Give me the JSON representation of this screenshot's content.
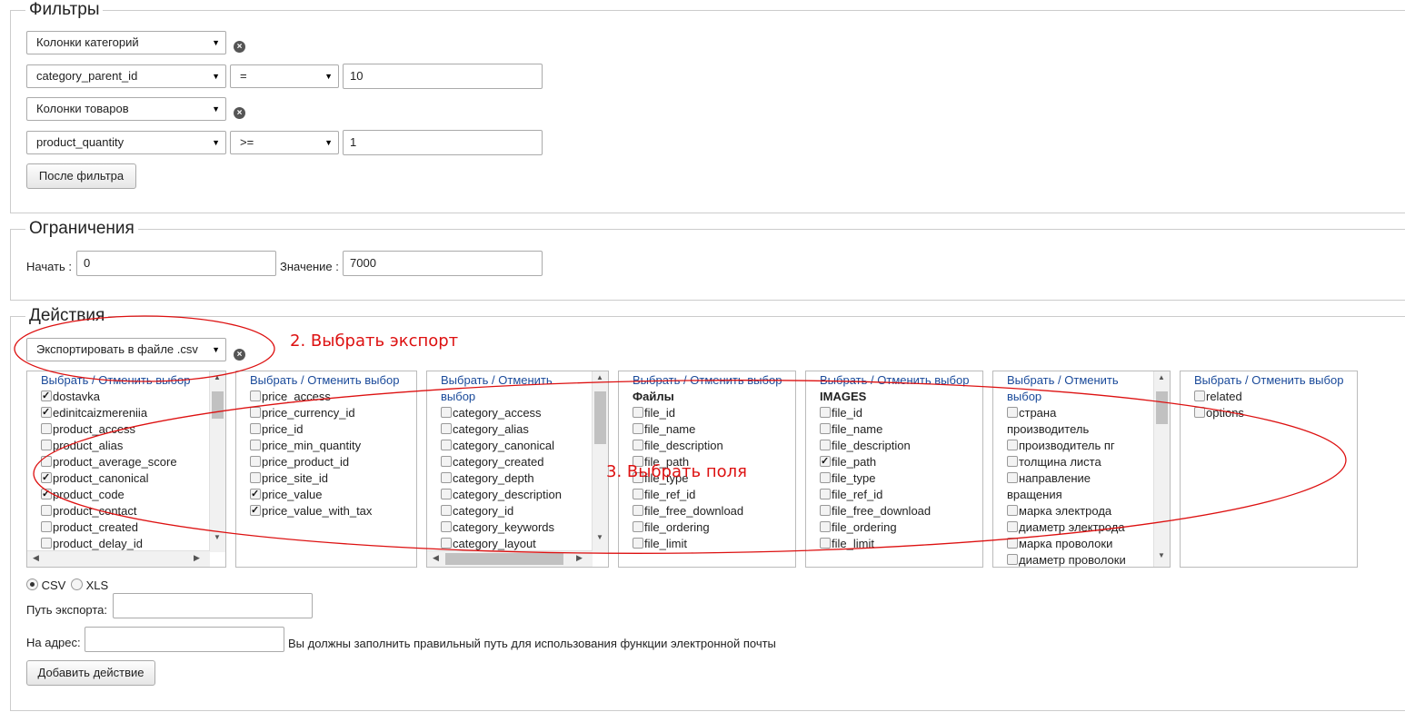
{
  "filters": {
    "legend": "Фильтры",
    "row1": {
      "select": "Колонки категорий"
    },
    "row2": {
      "field": "category_parent_id",
      "op": "=",
      "value": "10"
    },
    "row3": {
      "select": "Колонки товаров"
    },
    "row4": {
      "field": "product_quantity",
      "op": ">=",
      "value": "1"
    },
    "after_button": "После фильтра"
  },
  "limits": {
    "legend": "Ограничения",
    "start_label": "Начать :",
    "start_value": "0",
    "value_label": "Значение :",
    "value_value": "7000"
  },
  "actions": {
    "legend": "Действия",
    "action_select": "Экспортировать в файле .csv",
    "select_label": "Выбрать",
    "sep": "/",
    "unselect_label": "Отменить выбор",
    "unselect_wrap1": "Отменить",
    "unselect_wrap2": "выбор",
    "boxes": [
      {
        "items": [
          {
            "t": "dostavka",
            "c": true
          },
          {
            "t": "edinitcaizmereniia",
            "c": true
          },
          {
            "t": "product_access",
            "c": false
          },
          {
            "t": "product_alias",
            "c": false
          },
          {
            "t": "product_average_score",
            "c": false
          },
          {
            "t": "product_canonical",
            "c": true
          },
          {
            "t": "product_code",
            "c": true
          },
          {
            "t": "product_contact",
            "c": false
          },
          {
            "t": "product_created",
            "c": false
          },
          {
            "t": "product_delay_id",
            "c": false
          }
        ]
      },
      {
        "items": [
          {
            "t": "price_access",
            "c": false
          },
          {
            "t": "price_currency_id",
            "c": false
          },
          {
            "t": "price_id",
            "c": false
          },
          {
            "t": "price_min_quantity",
            "c": false
          },
          {
            "t": "price_product_id",
            "c": false
          },
          {
            "t": "price_site_id",
            "c": false
          },
          {
            "t": "price_value",
            "c": true
          },
          {
            "t": "price_value_with_tax",
            "c": true
          }
        ]
      },
      {
        "items": [
          {
            "t": "category_access",
            "c": false
          },
          {
            "t": "category_alias",
            "c": false
          },
          {
            "t": "category_canonical",
            "c": false
          },
          {
            "t": "category_created",
            "c": false
          },
          {
            "t": "category_depth",
            "c": false
          },
          {
            "t": "category_description",
            "c": false
          },
          {
            "t": "category_id",
            "c": false
          },
          {
            "t": "category_keywords",
            "c": false
          },
          {
            "t": "category_layout",
            "c": false
          }
        ]
      },
      {
        "group": "Файлы",
        "items": [
          {
            "t": "file_id",
            "c": false
          },
          {
            "t": "file_name",
            "c": false
          },
          {
            "t": "file_description",
            "c": false
          },
          {
            "t": "file_path",
            "c": false
          },
          {
            "t": "file_type",
            "c": false
          },
          {
            "t": "file_ref_id",
            "c": false
          },
          {
            "t": "file_free_download",
            "c": false
          },
          {
            "t": "file_ordering",
            "c": false
          },
          {
            "t": "file_limit",
            "c": false
          }
        ]
      },
      {
        "group": "IMAGES",
        "items": [
          {
            "t": "file_id",
            "c": false
          },
          {
            "t": "file_name",
            "c": false
          },
          {
            "t": "file_description",
            "c": false
          },
          {
            "t": "file_path",
            "c": true
          },
          {
            "t": "file_type",
            "c": false
          },
          {
            "t": "file_ref_id",
            "c": false
          },
          {
            "t": "file_free_download",
            "c": false
          },
          {
            "t": "file_ordering",
            "c": false
          },
          {
            "t": "file_limit",
            "c": false
          }
        ]
      },
      {
        "items": [
          {
            "t": "страна",
            "c": false
          },
          {
            "t": "производитель",
            "c": false,
            "wrap": true
          },
          {
            "t": "производитель пг",
            "c": false
          },
          {
            "t": "толщина листа",
            "c": false
          },
          {
            "t": "направление",
            "c": false
          },
          {
            "t": "вращения",
            "c": false,
            "wrap": true
          },
          {
            "t": "марка электрода",
            "c": false
          },
          {
            "t": "диаметр электрода",
            "c": false
          },
          {
            "t": "марка проволоки",
            "c": false
          },
          {
            "t": "диаметр проволоки",
            "c": false
          }
        ]
      },
      {
        "items": [
          {
            "t": "related",
            "c": false
          },
          {
            "t": "options",
            "c": false
          }
        ]
      }
    ],
    "format_csv": "CSV",
    "format_xls": "XLS",
    "export_path_label": "Путь экспорта:",
    "address_label": "На адрес:",
    "address_hint": "Вы должны заполнить правильный путь для использования функции электронной почты",
    "add_action_button": "Добавить действие"
  },
  "annotations": {
    "step2": "2. Выбрать экспорт",
    "step3": "3. Выбрать поля",
    "color": "#d11"
  }
}
